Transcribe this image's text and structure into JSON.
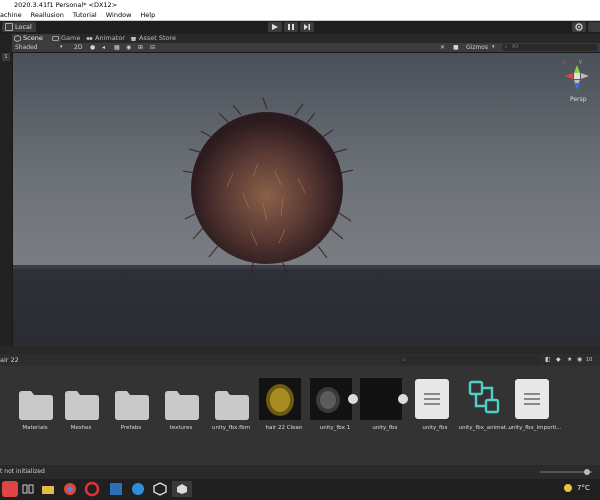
{
  "window": {
    "title": "2020.3.41f1 Personal* <DX12>"
  },
  "menu": [
    "achine",
    "Reallusion",
    "Tutorial",
    "Window",
    "Help"
  ],
  "toolbar": {
    "layout_label": "Local"
  },
  "tabs": [
    {
      "label": "Scene",
      "icon": "scene-icon"
    },
    {
      "label": "Game",
      "icon": "game-icon"
    },
    {
      "label": "Animator",
      "icon": "animator-icon"
    },
    {
      "label": "Asset Store",
      "icon": "asset-store-icon"
    }
  ],
  "scene_toolbar": {
    "shading_mode": "Shaded",
    "toggle_2d": "2D",
    "gizmos_label": "Gizmos",
    "search_placeholder": "All"
  },
  "left_strip": {
    "number": "1"
  },
  "scene_gizmo": {
    "x_label": "x",
    "y_label": "y",
    "view_label": "Persp"
  },
  "project": {
    "breadcrumb": "air 22",
    "count_label": "10",
    "assets": [
      {
        "name": "Materials",
        "type": "folder"
      },
      {
        "name": "Meshes",
        "type": "folder"
      },
      {
        "name": "Prefabs",
        "type": "folder"
      },
      {
        "name": "textures",
        "type": "folder"
      },
      {
        "name": "unity_fbx.fbm",
        "type": "folder"
      },
      {
        "name": "hair 22 Clean",
        "type": "texture-thumbnail"
      },
      {
        "name": "unity_fbx 1",
        "type": "model-thumbnail"
      },
      {
        "name": "unity_fbx",
        "type": "model-thumbnail"
      },
      {
        "name": "unity_fbx",
        "type": "document"
      },
      {
        "name": "unity_fbx_animat...",
        "type": "animator-controller"
      },
      {
        "name": "unity_fbx_Importi...",
        "type": "document"
      }
    ]
  },
  "status": {
    "message": "t not initialized"
  },
  "tray": {
    "temperature": "7°C"
  },
  "colors": {
    "accent_green": "#4fd1c5",
    "selection_blue": "#3a72b0"
  }
}
